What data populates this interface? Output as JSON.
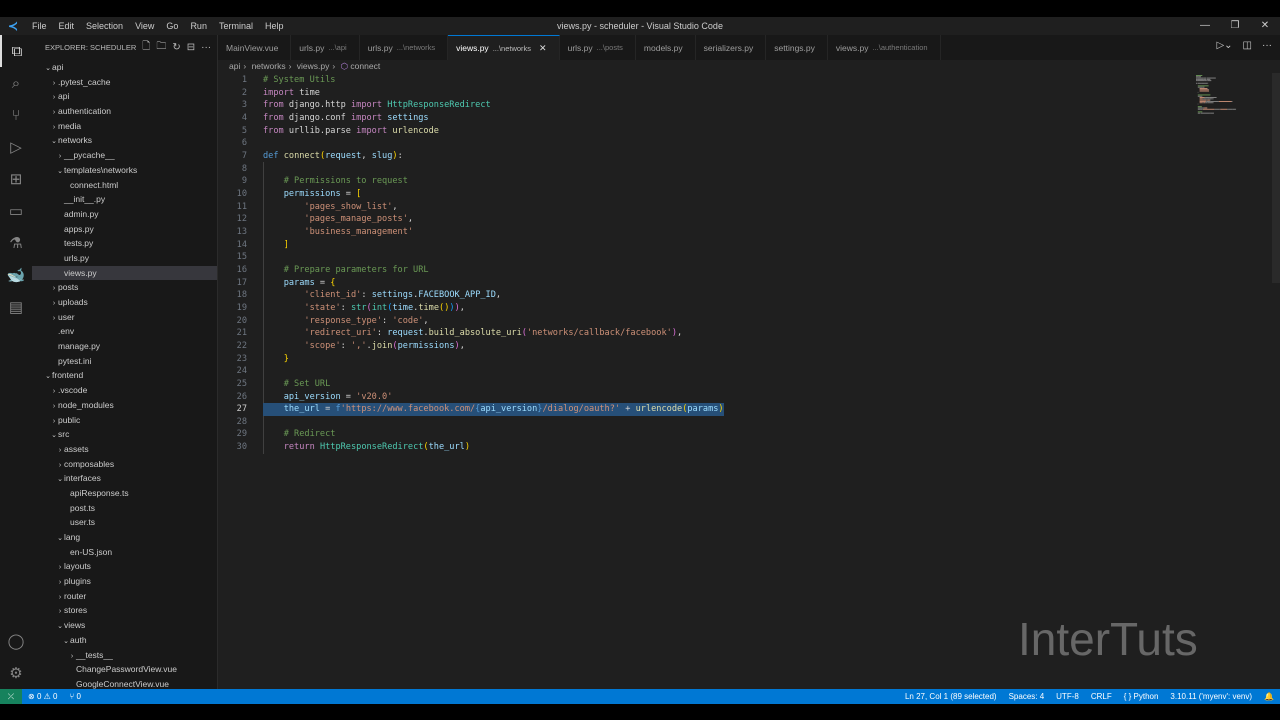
{
  "window": {
    "title": "views.py - scheduler - Visual Studio Code",
    "menu": [
      "File",
      "Edit",
      "Selection",
      "View",
      "Go",
      "Run",
      "Terminal",
      "Help"
    ]
  },
  "explorer": {
    "title": "EXPLORER: SCHEDULER",
    "tree": [
      {
        "label": "api",
        "d": 0,
        "type": "open"
      },
      {
        "label": ".pytest_cache",
        "d": 1,
        "type": "closed"
      },
      {
        "label": "api",
        "d": 1,
        "type": "closed"
      },
      {
        "label": "authentication",
        "d": 1,
        "type": "closed"
      },
      {
        "label": "media",
        "d": 1,
        "type": "closed"
      },
      {
        "label": "networks",
        "d": 1,
        "type": "open"
      },
      {
        "label": "__pycache__",
        "d": 2,
        "type": "closed"
      },
      {
        "label": "templates\\networks",
        "d": 2,
        "type": "open"
      },
      {
        "label": "connect.html",
        "d": 3,
        "type": "file"
      },
      {
        "label": "__init__.py",
        "d": 2,
        "type": "file"
      },
      {
        "label": "admin.py",
        "d": 2,
        "type": "file"
      },
      {
        "label": "apps.py",
        "d": 2,
        "type": "file"
      },
      {
        "label": "tests.py",
        "d": 2,
        "type": "file"
      },
      {
        "label": "urls.py",
        "d": 2,
        "type": "file"
      },
      {
        "label": "views.py",
        "d": 2,
        "type": "file",
        "selected": true
      },
      {
        "label": "posts",
        "d": 1,
        "type": "closed"
      },
      {
        "label": "uploads",
        "d": 1,
        "type": "closed"
      },
      {
        "label": "user",
        "d": 1,
        "type": "closed"
      },
      {
        "label": ".env",
        "d": 1,
        "type": "file"
      },
      {
        "label": "manage.py",
        "d": 1,
        "type": "file"
      },
      {
        "label": "pytest.ini",
        "d": 1,
        "type": "file"
      },
      {
        "label": "frontend",
        "d": 0,
        "type": "open"
      },
      {
        "label": ".vscode",
        "d": 1,
        "type": "closed"
      },
      {
        "label": "node_modules",
        "d": 1,
        "type": "closed"
      },
      {
        "label": "public",
        "d": 1,
        "type": "closed"
      },
      {
        "label": "src",
        "d": 1,
        "type": "open"
      },
      {
        "label": "assets",
        "d": 2,
        "type": "closed"
      },
      {
        "label": "composables",
        "d": 2,
        "type": "closed"
      },
      {
        "label": "interfaces",
        "d": 2,
        "type": "open"
      },
      {
        "label": "apiResponse.ts",
        "d": 3,
        "type": "file"
      },
      {
        "label": "post.ts",
        "d": 3,
        "type": "file"
      },
      {
        "label": "user.ts",
        "d": 3,
        "type": "file"
      },
      {
        "label": "lang",
        "d": 2,
        "type": "open"
      },
      {
        "label": "en-US.json",
        "d": 3,
        "type": "file"
      },
      {
        "label": "layouts",
        "d": 2,
        "type": "closed"
      },
      {
        "label": "plugins",
        "d": 2,
        "type": "closed"
      },
      {
        "label": "router",
        "d": 2,
        "type": "closed"
      },
      {
        "label": "stores",
        "d": 2,
        "type": "closed"
      },
      {
        "label": "views",
        "d": 2,
        "type": "open"
      },
      {
        "label": "auth",
        "d": 3,
        "type": "open"
      },
      {
        "label": "__tests__",
        "d": 4,
        "type": "closed"
      },
      {
        "label": "ChangePasswordView.vue",
        "d": 4,
        "type": "file"
      },
      {
        "label": "GoogleConnectView.vue",
        "d": 4,
        "type": "file"
      }
    ]
  },
  "tabs": [
    {
      "name": "MainView.vue",
      "desc": ""
    },
    {
      "name": "urls.py",
      "desc": "...\\api"
    },
    {
      "name": "urls.py",
      "desc": "...\\networks"
    },
    {
      "name": "views.py",
      "desc": "...\\networks",
      "active": true
    },
    {
      "name": "urls.py",
      "desc": "...\\posts"
    },
    {
      "name": "models.py",
      "desc": ""
    },
    {
      "name": "serializers.py",
      "desc": ""
    },
    {
      "name": "settings.py",
      "desc": ""
    },
    {
      "name": "views.py",
      "desc": "...\\authentication"
    }
  ],
  "breadcrumb": [
    "api",
    "networks",
    "views.py",
    "connect"
  ],
  "code": [
    [
      [
        "c",
        "# System Utils"
      ]
    ],
    [
      [
        "k",
        "import"
      ],
      [
        "p",
        " time"
      ]
    ],
    [
      [
        "k",
        "from"
      ],
      [
        "p",
        " django.http "
      ],
      [
        "k",
        "import"
      ],
      [
        "p",
        " "
      ],
      [
        "t",
        "HttpResponseRedirect"
      ]
    ],
    [
      [
        "k",
        "from"
      ],
      [
        "p",
        " django.conf "
      ],
      [
        "k",
        "import"
      ],
      [
        "p",
        " "
      ],
      [
        "v",
        "settings"
      ]
    ],
    [
      [
        "k",
        "from"
      ],
      [
        "p",
        " urllib.parse "
      ],
      [
        "k",
        "import"
      ],
      [
        "p",
        " "
      ],
      [
        "f",
        "urlencode"
      ]
    ],
    [],
    [
      [
        "kb",
        "def"
      ],
      [
        "p",
        " "
      ],
      [
        "f",
        "connect"
      ],
      [
        "b",
        "("
      ],
      [
        "v",
        "request"
      ],
      [
        "p",
        ", "
      ],
      [
        "v",
        "slug"
      ],
      [
        "b",
        ")"
      ],
      [
        "p",
        ":"
      ]
    ],
    [],
    [
      [
        "p",
        "    "
      ],
      [
        "c",
        "# Permissions to request"
      ]
    ],
    [
      [
        "p",
        "    "
      ],
      [
        "v",
        "permissions"
      ],
      [
        "p",
        " = "
      ],
      [
        "b",
        "["
      ]
    ],
    [
      [
        "p",
        "        "
      ],
      [
        "s",
        "'pages_show_list'"
      ],
      [
        "p",
        ","
      ]
    ],
    [
      [
        "p",
        "        "
      ],
      [
        "s",
        "'pages_manage_posts'"
      ],
      [
        "p",
        ","
      ]
    ],
    [
      [
        "p",
        "        "
      ],
      [
        "s",
        "'business_management'"
      ]
    ],
    [
      [
        "p",
        "    "
      ],
      [
        "b",
        "]"
      ]
    ],
    [],
    [
      [
        "p",
        "    "
      ],
      [
        "c",
        "# Prepare parameters for URL"
      ]
    ],
    [
      [
        "p",
        "    "
      ],
      [
        "v",
        "params"
      ],
      [
        "p",
        " = "
      ],
      [
        "b",
        "{"
      ]
    ],
    [
      [
        "p",
        "        "
      ],
      [
        "s",
        "'client_id'"
      ],
      [
        "p",
        ": "
      ],
      [
        "v",
        "settings"
      ],
      [
        "p",
        "."
      ],
      [
        "v",
        "FACEBOOK_APP_ID"
      ],
      [
        "p",
        ","
      ]
    ],
    [
      [
        "p",
        "        "
      ],
      [
        "s",
        "'state'"
      ],
      [
        "p",
        ": "
      ],
      [
        "t",
        "str"
      ],
      [
        "b2",
        "("
      ],
      [
        "t",
        "int"
      ],
      [
        "b3",
        "("
      ],
      [
        "v",
        "time"
      ],
      [
        "p",
        "."
      ],
      [
        "f",
        "time"
      ],
      [
        "b",
        "()"
      ],
      [
        "b3",
        ")"
      ],
      [
        "b2",
        ")"
      ],
      [
        "p",
        ","
      ]
    ],
    [
      [
        "p",
        "        "
      ],
      [
        "s",
        "'response_type'"
      ],
      [
        "p",
        ": "
      ],
      [
        "s",
        "'code'"
      ],
      [
        "p",
        ","
      ]
    ],
    [
      [
        "p",
        "        "
      ],
      [
        "s",
        "'redirect_uri'"
      ],
      [
        "p",
        ": "
      ],
      [
        "v",
        "request"
      ],
      [
        "p",
        "."
      ],
      [
        "f",
        "build_absolute_uri"
      ],
      [
        "b2",
        "("
      ],
      [
        "s",
        "'networks/callback/facebook'"
      ],
      [
        "b2",
        ")"
      ],
      [
        "p",
        ","
      ]
    ],
    [
      [
        "p",
        "        "
      ],
      [
        "s",
        "'scope'"
      ],
      [
        "p",
        ": "
      ],
      [
        "s",
        "','"
      ],
      [
        "p",
        "."
      ],
      [
        "f",
        "join"
      ],
      [
        "b2",
        "("
      ],
      [
        "v",
        "permissions"
      ],
      [
        "b2",
        ")"
      ],
      [
        "p",
        ","
      ]
    ],
    [
      [
        "p",
        "    "
      ],
      [
        "b",
        "}"
      ]
    ],
    [],
    [
      [
        "p",
        "    "
      ],
      [
        "c",
        "# Set URL"
      ]
    ],
    [
      [
        "p",
        "    "
      ],
      [
        "v",
        "api_version"
      ],
      [
        "p",
        " = "
      ],
      [
        "s",
        "'v20.0'"
      ]
    ],
    [
      [
        "p",
        "    "
      ],
      [
        "v",
        "the_url"
      ],
      [
        "p",
        " = "
      ],
      [
        "kb",
        "f"
      ],
      [
        "s",
        "'https://www.facebook.com/"
      ],
      [
        "kb",
        "{"
      ],
      [
        "v",
        "api_version"
      ],
      [
        "kb",
        "}"
      ],
      [
        "s",
        "/dialog/oauth?'"
      ],
      [
        "p",
        " + "
      ],
      [
        "f",
        "urlencode"
      ],
      [
        "b",
        "("
      ],
      [
        "v",
        "params"
      ],
      [
        "b",
        ")"
      ]
    ],
    [],
    [
      [
        "p",
        "    "
      ],
      [
        "c",
        "# Redirect"
      ]
    ],
    [
      [
        "p",
        "    "
      ],
      [
        "k",
        "return"
      ],
      [
        "p",
        " "
      ],
      [
        "t",
        "HttpResponseRedirect"
      ],
      [
        "b",
        "("
      ],
      [
        "v",
        "the_url"
      ],
      [
        "b",
        ")"
      ]
    ]
  ],
  "cursor_line": 27,
  "status": {
    "errors": "0",
    "warnings": "0",
    "ports": "0",
    "position": "Ln 27, Col 1 (89 selected)",
    "spaces": "Spaces: 4",
    "encoding": "UTF-8",
    "eol": "CRLF",
    "language": "Python",
    "interpreter": "3.10.11 ('myenv': venv)"
  },
  "watermark": "InterTuts"
}
